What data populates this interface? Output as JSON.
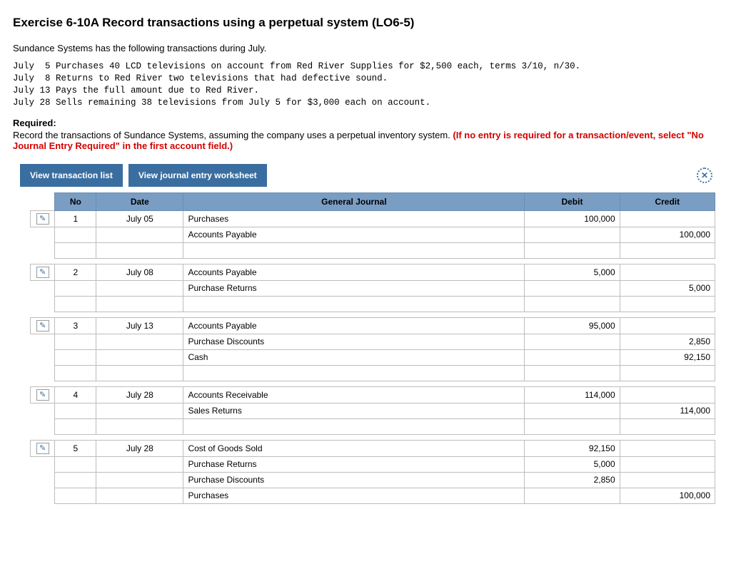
{
  "title": "Exercise 6-10A Record transactions using a perpetual system (LO6-5)",
  "intro": "Sundance Systems has the following transactions during July.",
  "txn_lines": "July  5 Purchases 40 LCD televisions on account from Red River Supplies for $2,500 each, terms 3/10, n/30.\nJuly  8 Returns to Red River two televisions that had defective sound.\nJuly 13 Pays the full amount due to Red River.\nJuly 28 Sells remaining 38 televisions from July 5 for $3,000 each on account.",
  "required_head": "Required:",
  "required_text": "Record the transactions of Sundance Systems, assuming the company uses a perpetual inventory system. ",
  "required_red": "(If no entry is required for a transaction/event, select \"No Journal Entry Required\" in the first account field.)",
  "buttons": {
    "view_list": "View transaction list",
    "view_worksheet": "View journal entry worksheet"
  },
  "headers": {
    "no": "No",
    "date": "Date",
    "gj": "General Journal",
    "debit": "Debit",
    "credit": "Credit"
  },
  "rows": [
    {
      "type": "entry",
      "edit": true,
      "no": "1",
      "date": "July 05",
      "desc": "Purchases",
      "indent": 0,
      "debit": "100,000",
      "credit": ""
    },
    {
      "type": "line",
      "desc": "Accounts Payable",
      "indent": 1,
      "debit": "",
      "credit": "100,000"
    },
    {
      "type": "line",
      "desc": "",
      "indent": 0,
      "debit": "",
      "credit": ""
    },
    {
      "type": "gap"
    },
    {
      "type": "entry",
      "edit": true,
      "no": "2",
      "date": "July 08",
      "desc": "Accounts Payable",
      "indent": 0,
      "debit": "5,000",
      "credit": ""
    },
    {
      "type": "line",
      "desc": "Purchase Returns",
      "indent": 1,
      "debit": "",
      "credit": "5,000"
    },
    {
      "type": "line",
      "desc": "",
      "indent": 0,
      "debit": "",
      "credit": ""
    },
    {
      "type": "gap"
    },
    {
      "type": "entry",
      "edit": true,
      "no": "3",
      "date": "July 13",
      "desc": "Accounts Payable",
      "indent": 0,
      "debit": "95,000",
      "credit": ""
    },
    {
      "type": "line",
      "desc": "Purchase Discounts",
      "indent": 1,
      "debit": "",
      "credit": "2,850"
    },
    {
      "type": "line",
      "desc": "Cash",
      "indent": 1,
      "debit": "",
      "credit": "92,150"
    },
    {
      "type": "line",
      "desc": "",
      "indent": 0,
      "debit": "",
      "credit": ""
    },
    {
      "type": "gap"
    },
    {
      "type": "entry",
      "edit": true,
      "no": "4",
      "date": "July 28",
      "desc": "Accounts Receivable",
      "indent": 0,
      "debit": "114,000",
      "credit": ""
    },
    {
      "type": "line",
      "desc": "Sales Returns",
      "indent": 1,
      "debit": "",
      "credit": "114,000"
    },
    {
      "type": "line",
      "desc": "",
      "indent": 0,
      "debit": "",
      "credit": ""
    },
    {
      "type": "gap"
    },
    {
      "type": "entry",
      "edit": true,
      "no": "5",
      "date": "July 28",
      "desc": "Cost of Goods Sold",
      "indent": 0,
      "debit": "92,150",
      "credit": ""
    },
    {
      "type": "line",
      "desc": "Purchase Returns",
      "indent": 0,
      "debit": "5,000",
      "credit": ""
    },
    {
      "type": "line",
      "desc": "Purchase Discounts",
      "indent": 0,
      "debit": "2,850",
      "credit": ""
    },
    {
      "type": "line",
      "desc": "Purchases",
      "indent": 1,
      "debit": "",
      "credit": "100,000"
    }
  ]
}
